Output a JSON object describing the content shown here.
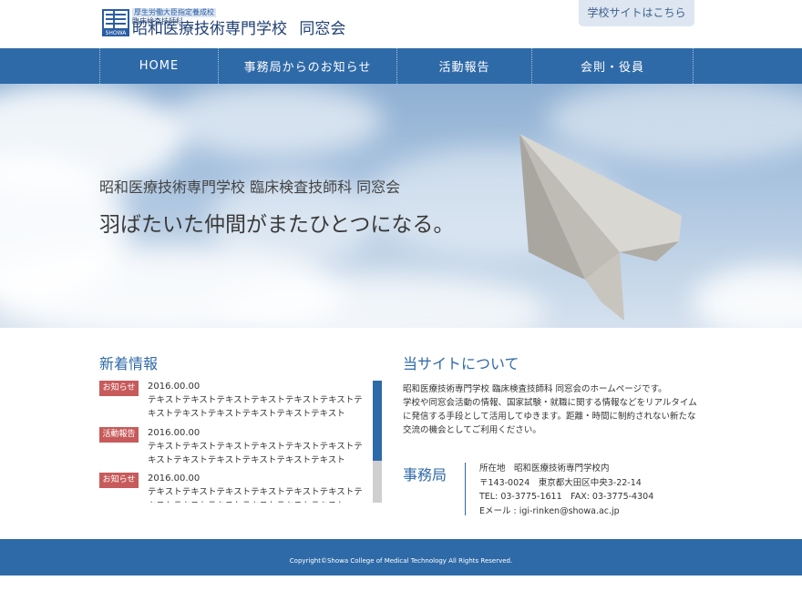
{
  "header": {
    "logo": {
      "designation": "厚生労働大臣指定養成校",
      "department": "臨床検査技師科",
      "title": "昭和医療技術専門学校",
      "association": "同窓会",
      "mark_text": "SHOWA"
    },
    "school_site_link": "学校サイトはこちら"
  },
  "nav": {
    "items": [
      {
        "label": "HOME"
      },
      {
        "label": "事務局からのお知らせ"
      },
      {
        "label": "活動報告"
      },
      {
        "label": "会則・役員"
      }
    ]
  },
  "hero": {
    "subtitle": "昭和医療技術専門学校 臨床検査技師科 同窓会",
    "title": "羽ばたいた仲間がまたひとつになる。"
  },
  "news": {
    "heading": "新着情報",
    "scroll_fraction": 0.66,
    "items": [
      {
        "badge": "お知らせ",
        "date": "2016.00.00",
        "text": "テキストテキストテキストテキストテキストテキストテキストテキストテキストテキストテキストテキスト"
      },
      {
        "badge": "活動報告",
        "date": "2016.00.00",
        "text": "テキストテキストテキストテキストテキストテキストテキストテキストテキストテキストテキストテキスト"
      },
      {
        "badge": "お知らせ",
        "date": "2016.00.00",
        "text": "テキストテキストテキストテキストテキストテキストテキストテキストテキストテキストテキストテキスト"
      }
    ]
  },
  "about": {
    "heading": "当サイトについて",
    "lines": [
      "昭和医療技術専門学校 臨床検査技師科 同窓会のホームページです。",
      "学校や同窓会活動の情報、国家試験・就職に関する情報などをリアルタイム",
      "に発信する手段として活用してゆきます。距離・時間に制約されない新たな",
      "交流の機会としてご利用ください。"
    ]
  },
  "office": {
    "heading": "事務局",
    "lines": [
      "所在地　昭和医療技術専門学校内",
      "〒143-0024　東京都大田区中央3-22-14",
      "TEL: 03-3775-1611　FAX: 03-3775-4304",
      "Eメール : igi-rinken@showa.ac.jp"
    ]
  },
  "footer": {
    "copyright": "Copyright©Showa College of Medical Technology All Rights Reserved."
  },
  "colors": {
    "primary": "#2f6aa8",
    "badge": "#c75b5b",
    "link_button_bg": "#dde6f1"
  }
}
